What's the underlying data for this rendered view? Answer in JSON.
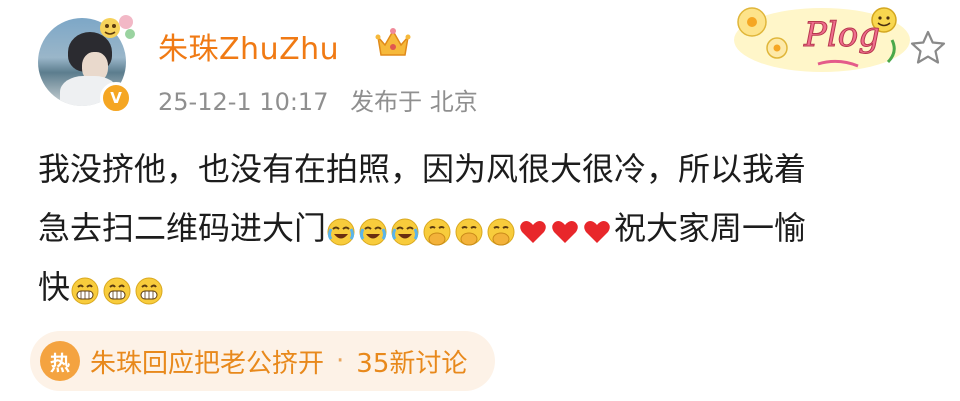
{
  "user": {
    "name": "朱珠ZhuZhu",
    "verified_badge": "V"
  },
  "meta": {
    "time": "25-12-1 10:17",
    "location": "发布于 北京"
  },
  "sticker": {
    "text": "Plog"
  },
  "post": {
    "line1": "我没挤他，也没有在拍照，因为风很大很冷，所以我着",
    "line2_a": "急去扫二维码进大门",
    "line2_b": "祝大家周一愉",
    "line3": "快"
  },
  "topic": {
    "icon_text": "热",
    "title": "朱珠回应把老公挤开",
    "separator": "·",
    "count": "35新讨论"
  },
  "icons": [
    "crown-icon",
    "star-icon",
    "verified-badge-icon",
    "laugh-cry-emoji",
    "hand-cover-mouth-emoji",
    "heart-emoji",
    "grin-emoji"
  ],
  "colors": {
    "accent": "#f07a14",
    "topic_bg": "#fdf2e7",
    "meta": "#8f8f8f"
  }
}
